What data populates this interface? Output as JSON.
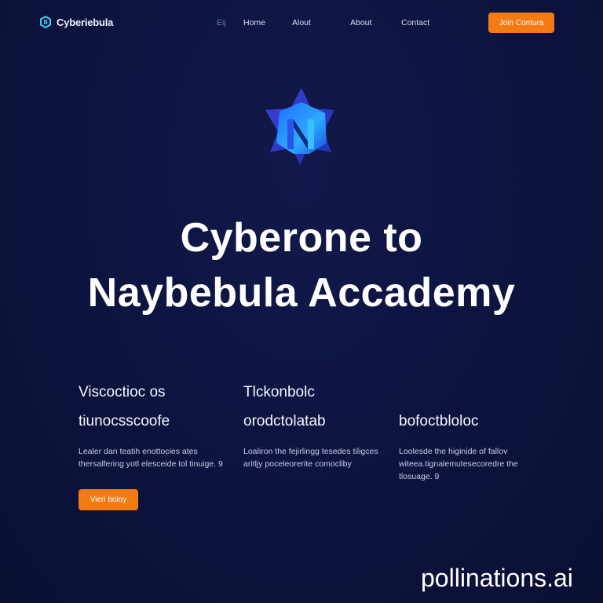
{
  "nav": {
    "brand": "Cyberiebula",
    "links": [
      "Eij",
      "Home",
      "Alout",
      "About",
      "Contact"
    ],
    "join_label": "Join Contura"
  },
  "hero": {
    "title_line1": "Cyberone to",
    "title_line2": "Naybebula Accademy"
  },
  "features": [
    {
      "heading1": "Viscoctioc os",
      "heading2": "tiunocsscoofe",
      "body": "Lealer dan teatih enottocies ates thersalfering yotl elesceide tol tinuige. 9"
    },
    {
      "heading1": "Tlckonbolc",
      "heading2": "orodctolatab",
      "body": "Loaliron the fejirlingg tesedes tiligces aritljy poceleorerite comocliby"
    },
    {
      "heading1": "",
      "heading2": "bofoctbloloc",
      "body": "Loolesde the higinide of fallov witeea.tignalemutesecoredre the tlosuage. 9"
    }
  ],
  "cta": {
    "view_label": "Vieri boloy"
  },
  "watermark": "pollinations.ai",
  "colors": {
    "background": "#0d1440",
    "accent": "#f47b14",
    "logo_blue": "#2f57ff",
    "logo_cyan": "#2aa8ff"
  },
  "icons": {
    "brand": "hexagon-logo-icon",
    "hero": "star-crystal-logo-icon"
  }
}
